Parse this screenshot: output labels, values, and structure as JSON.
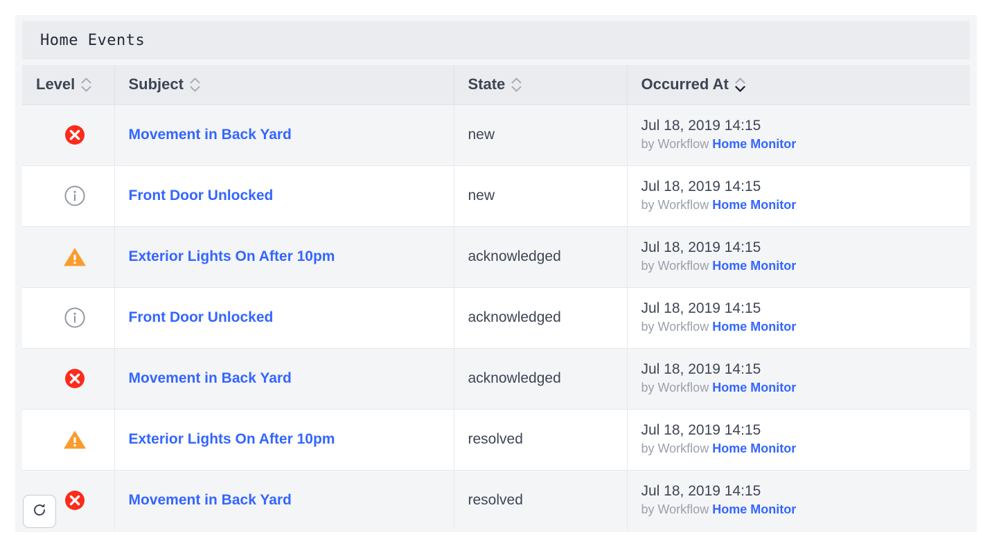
{
  "card": {
    "title": "Home Events"
  },
  "table": {
    "columns": [
      {
        "label": "Level",
        "key": "level",
        "sort_icon": "sort-both-icon",
        "sorted": "none"
      },
      {
        "label": "Subject",
        "key": "subject",
        "sort_icon": "sort-both-icon",
        "sorted": "none"
      },
      {
        "label": "State",
        "key": "state",
        "sort_icon": "sort-both-icon",
        "sorted": "none"
      },
      {
        "label": "Occurred At",
        "key": "time",
        "sort_icon": "sort-descending-icon",
        "sorted": "desc"
      }
    ],
    "rows": [
      {
        "level": "error",
        "level_icon": "error-circle-icon",
        "subject": "Movement in Back Yard",
        "state": "new",
        "time": "Jul 18, 2019 14:15",
        "by_prefix": "by Workflow",
        "workflow": "Home Monitor"
      },
      {
        "level": "info",
        "level_icon": "info-circle-icon",
        "subject": "Front Door Unlocked",
        "state": "new",
        "time": "Jul 18, 2019 14:15",
        "by_prefix": "by Workflow",
        "workflow": "Home Monitor"
      },
      {
        "level": "warning",
        "level_icon": "warning-triangle-icon",
        "subject": "Exterior Lights On After 10pm",
        "state": "acknowledged",
        "time": "Jul 18, 2019 14:15",
        "by_prefix": "by Workflow",
        "workflow": "Home Monitor"
      },
      {
        "level": "info",
        "level_icon": "info-circle-icon",
        "subject": "Front Door Unlocked",
        "state": "acknowledged",
        "time": "Jul 18, 2019 14:15",
        "by_prefix": "by Workflow",
        "workflow": "Home Monitor"
      },
      {
        "level": "error",
        "level_icon": "error-circle-icon",
        "subject": "Movement in Back Yard",
        "state": "acknowledged",
        "time": "Jul 18, 2019 14:15",
        "by_prefix": "by Workflow",
        "workflow": "Home Monitor"
      },
      {
        "level": "warning",
        "level_icon": "warning-triangle-icon",
        "subject": "Exterior Lights On After 10pm",
        "state": "resolved",
        "time": "Jul 18, 2019 14:15",
        "by_prefix": "by Workflow",
        "workflow": "Home Monitor"
      },
      {
        "level": "error",
        "level_icon": "error-circle-icon",
        "subject": "Movement in Back Yard",
        "state": "resolved",
        "time": "Jul 18, 2019 14:15",
        "by_prefix": "by Workflow",
        "workflow": "Home Monitor"
      }
    ]
  },
  "refresh_button": {
    "icon": "refresh-icon",
    "title": "Refresh"
  },
  "colors": {
    "link": "#3366ff",
    "error": "#fc2b1b",
    "warning": "#fb9b2c",
    "info": "#8d939e",
    "text": "#3d4554",
    "muted": "#9aa0ab",
    "header_bg": "#eaecef",
    "row_odd_bg": "#f4f5f7",
    "row_even_bg": "#ffffff",
    "card_bg": "#f4f5f7",
    "title_text": "#242a38"
  }
}
